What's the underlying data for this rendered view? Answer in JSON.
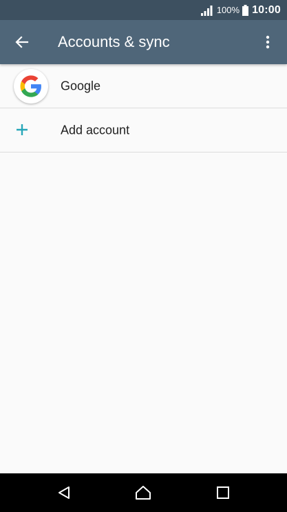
{
  "status_bar": {
    "battery_percent": "100%",
    "time": "10:00",
    "icons": [
      "signal-icon",
      "battery-icon"
    ]
  },
  "app_bar": {
    "title": "Accounts & sync",
    "icons": [
      "back-arrow-icon",
      "overflow-menu-icon"
    ]
  },
  "accounts": [
    {
      "label": "Google",
      "icon": "google-logo-icon"
    }
  ],
  "add_account": {
    "label": "Add account",
    "icon": "plus-icon"
  },
  "nav_bar": {
    "icons": [
      "back-triangle-icon",
      "home-icon",
      "recents-icon"
    ]
  },
  "colors": {
    "status_bar": "#3d5060",
    "app_bar": "#4f6679",
    "accent": "#26a6b8",
    "background": "#fafafa"
  }
}
